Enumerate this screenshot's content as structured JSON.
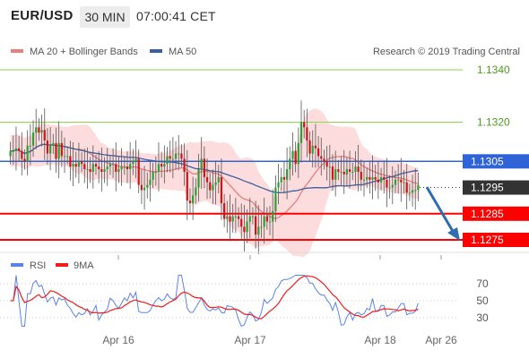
{
  "header": {
    "symbol": "EUR/USD",
    "timeframe": "30 MIN",
    "time": "07:00:41 CET"
  },
  "legend": {
    "ma20_bollinger": "MA 20 + Bollinger Bands",
    "ma50": "MA 50",
    "copyright": "Research © 2019 Trading Central"
  },
  "rsi_legend": {
    "rsi": "RSI",
    "ma9": "9MA"
  },
  "colors": {
    "candle_up": "#2f9e36",
    "candle_down": "#cf1515",
    "ma20": "#e87f7f",
    "bollinger_fill": "#fbd6d6",
    "ma50": "#3c5fa0",
    "resistance": "#8cd64a",
    "current_level": "#2f63d8",
    "support": "#ff0000",
    "rsi_line": "#5b82e8",
    "rsi_ma": "#ee1c1c",
    "forecast_arrow": "#2e6db0",
    "price_tag": "#333333"
  },
  "chart_data": {
    "type": "candlestick",
    "y_range": [
      1.1267,
      1.135
    ],
    "levels": [
      {
        "label": "1.1340",
        "value": 1.134,
        "kind": "resistance"
      },
      {
        "label": "1.1320",
        "value": 1.132,
        "kind": "resistance"
      },
      {
        "label": "1.1305",
        "value": 1.1305,
        "kind": "current"
      },
      {
        "label": "1.1295",
        "value": 1.1295,
        "kind": "last_price"
      },
      {
        "label": "1.1285",
        "value": 1.1285,
        "kind": "support"
      },
      {
        "label": "1.1275",
        "value": 1.1275,
        "kind": "support"
      }
    ],
    "x_ticks": [
      "Apr 16",
      "Apr 17",
      "Apr 18",
      "Apr 26"
    ],
    "rsi_ticks": [
      "70",
      "50",
      "30"
    ],
    "close": [
      1.1309,
      1.1309,
      1.131,
      1.1309,
      1.1306,
      1.1305,
      1.1311,
      1.1311,
      1.1316,
      1.1318,
      1.1316,
      1.1317,
      1.1313,
      1.1308,
      1.1311,
      1.1312,
      1.1306,
      1.1312,
      1.1307,
      1.1307,
      1.1307,
      1.1303,
      1.1304,
      1.1303,
      1.1305,
      1.1304,
      1.1302,
      1.1302,
      1.1301,
      1.1304,
      1.1303,
      1.1302,
      1.1301,
      1.1302,
      1.1303,
      1.1304,
      1.1304,
      1.1301,
      1.1302,
      1.1303,
      1.1303,
      1.1302,
      1.1304,
      1.1305,
      1.1306,
      1.1296,
      1.1294,
      1.1295,
      1.1296,
      1.1298,
      1.1301,
      1.1301,
      1.1304,
      1.1303,
      1.1304,
      1.1307,
      1.1306,
      1.1306,
      1.1308,
      1.1308,
      1.1306,
      1.1301,
      1.129,
      1.1289,
      1.1292,
      1.1295,
      1.1302,
      1.1306,
      1.1299,
      1.1297,
      1.1294,
      1.1296,
      1.1297,
      1.1299,
      1.1289,
      1.1283,
      1.1284,
      1.1282,
      1.1284,
      1.1284,
      1.1283,
      1.128,
      1.1278,
      1.1282,
      1.1284,
      1.1284,
      1.1277,
      1.128,
      1.128,
      1.1284,
      1.1282,
      1.1282,
      1.1286,
      1.1295,
      1.1297,
      1.1299,
      1.1298,
      1.1302,
      1.1306,
      1.1309,
      1.1304,
      1.1312,
      1.132,
      1.1318,
      1.1313,
      1.1308,
      1.1311,
      1.131,
      1.1307,
      1.1306,
      1.1305,
      1.1303,
      1.1303,
      1.1298,
      1.1302,
      1.1301,
      1.1301,
      1.13,
      1.1302,
      1.1301,
      1.1301,
      1.1303,
      1.1301,
      1.1298,
      1.1298,
      1.1299,
      1.1298,
      1.1299,
      1.1298,
      1.1297,
      1.1299,
      1.1298,
      1.1295,
      1.1295,
      1.1296,
      1.1298,
      1.1298,
      1.1297,
      1.1297,
      1.1293,
      1.1293,
      1.1294,
      1.1294,
      1.1296
    ]
  }
}
